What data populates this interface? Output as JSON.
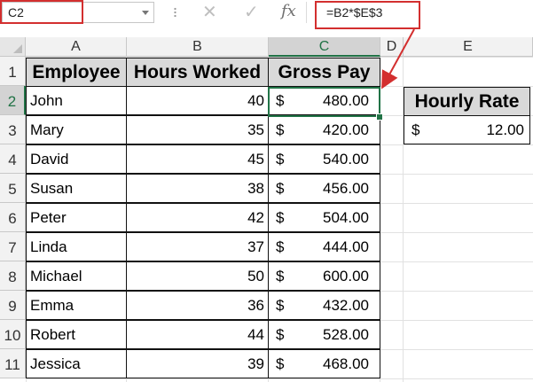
{
  "formula_bar": {
    "name_box": "C2",
    "formula": "=B2*$E$3",
    "icons": [
      "cancel-icon",
      "enter-icon",
      "function-icon"
    ],
    "cancel_glyph": "✕",
    "enter_glyph": "✓",
    "fx_glyph": "fx"
  },
  "columns": [
    "A",
    "B",
    "C",
    "D",
    "E"
  ],
  "rows": [
    "1",
    "2",
    "3",
    "4",
    "5",
    "6",
    "7",
    "8",
    "9",
    "10",
    "11"
  ],
  "table": {
    "headers": [
      "Employee",
      "Hours Worked",
      "Gross Pay"
    ],
    "currency_symbol": "$",
    "records": [
      {
        "name": "John",
        "hours": "40",
        "pay": "480.00"
      },
      {
        "name": "Mary",
        "hours": "35",
        "pay": "420.00"
      },
      {
        "name": "David",
        "hours": "45",
        "pay": "540.00"
      },
      {
        "name": "Susan",
        "hours": "38",
        "pay": "456.00"
      },
      {
        "name": "Peter",
        "hours": "42",
        "pay": "504.00"
      },
      {
        "name": "Linda",
        "hours": "37",
        "pay": "444.00"
      },
      {
        "name": "Michael",
        "hours": "50",
        "pay": "600.00"
      },
      {
        "name": "Emma",
        "hours": "36",
        "pay": "432.00"
      },
      {
        "name": "Robert",
        "hours": "44",
        "pay": "528.00"
      },
      {
        "name": "Jessica",
        "hours": "39",
        "pay": "468.00"
      }
    ]
  },
  "rate_table": {
    "header": "Hourly Rate",
    "currency_symbol": "$",
    "value": "12.00"
  },
  "colors": {
    "excel_green": "#217346",
    "annotation_red": "#d32f2f",
    "header_fill": "#d9d9d9"
  }
}
